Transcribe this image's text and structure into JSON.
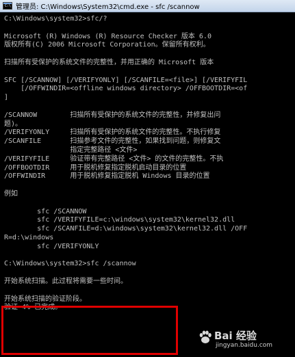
{
  "window": {
    "title": "管理员: C:\\Windows\\System32\\cmd.exe - sfc /scannow",
    "icon_label": "C:\\"
  },
  "console": {
    "lines": [
      "C:\\Windows\\system32>sfc/?",
      "",
      "Microsoft (R) Windows (R) Resource Checker 版本 6.0",
      "版权所有(C) 2006 Microsoft Corporation。保留所有权利。",
      "",
      "扫描所有受保护的系统文件的完整性，并用正确的 Microsoft 版本",
      "",
      "SFC [/SCANNOW] [/VERIFYONLY] [/SCANFILE=<file>] [/VERIFYFIL",
      "    [/OFFWINDIR=<offline windows directory> /OFFBOOTDIR=<of",
      "]",
      "",
      "/SCANNOW        扫描所有受保护的系统文件的完整性，并修复出问",
      "题)。",
      "/VERIFYONLY     扫描所有受保护的系统文件的完整性。不执行修复",
      "/SCANFILE       扫描参考文件的完整性，如果找到问题，则修复文",
      "                指定完整路径 <文件>",
      "/VERIFYFILE     验证带有完整路径 <文件> 的文件的完整性。不执",
      "/OFFBOOTDIR     用于脱机修复指定脱机启动目录的位置",
      "/OFFWINDIR      用于脱机修复指定脱机 Windows 目录的位置",
      "",
      "例如",
      "",
      "        sfc /SCANNOW",
      "        sfc /VERIFYFILE=c:\\windows\\system32\\kernel32.dll",
      "        sfc /SCANFILE=d:\\windows\\system32\\kernel32.dll /OFF",
      "R=d:\\windows",
      "        sfc /VERIFYONLY",
      "",
      "C:\\Windows\\system32>sfc /scannow",
      "",
      "开始系统扫描。此过程将需要一些时间。",
      "",
      "开始系统扫描的验证阶段。",
      "验证 4% 已完成。"
    ]
  },
  "watermark": {
    "brand": "Bai 经验",
    "url": "jingyan.baidu.com"
  },
  "colors": {
    "console_bg": "#000000",
    "console_text": "#c0c0c0",
    "highlight": "#e00000"
  }
}
